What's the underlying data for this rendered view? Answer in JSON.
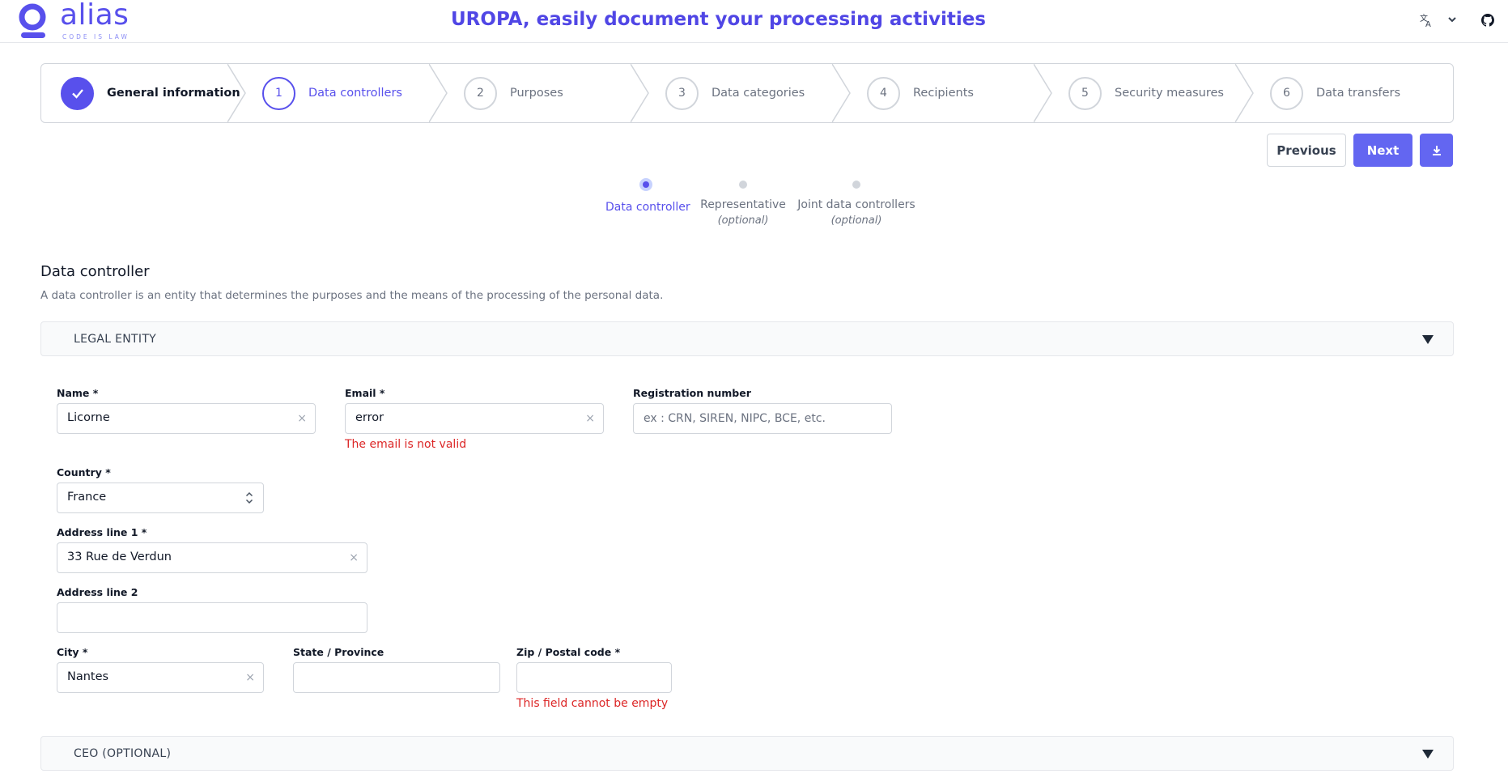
{
  "header": {
    "logo_word": "alias",
    "logo_tagline": "CODE IS LAW",
    "title": "UROPA, easily document your processing activities",
    "lang_icon": "translate-icon",
    "github_icon": "github-icon"
  },
  "steps": [
    {
      "number": "",
      "label": "General information",
      "state": "done"
    },
    {
      "number": "1",
      "label": "Data controllers",
      "state": "current"
    },
    {
      "number": "2",
      "label": "Purposes",
      "state": "todo"
    },
    {
      "number": "3",
      "label": "Data categories",
      "state": "todo"
    },
    {
      "number": "4",
      "label": "Recipients",
      "state": "todo"
    },
    {
      "number": "5",
      "label": "Security measures",
      "state": "todo"
    },
    {
      "number": "6",
      "label": "Data transfers",
      "state": "todo"
    }
  ],
  "nav": {
    "previous": "Previous",
    "next": "Next",
    "download_icon": "download-icon"
  },
  "substeps": [
    {
      "label": "Data controller",
      "optional": "",
      "active": true
    },
    {
      "label": "Representative",
      "optional": "(optional)",
      "active": false
    },
    {
      "label": "Joint data controllers",
      "optional": "(optional)",
      "active": false
    }
  ],
  "section": {
    "title": "Data controller",
    "description": "A data controller is an entity that determines the purposes and the means of the processing of the personal data."
  },
  "accordions": {
    "legal_entity": "LEGAL ENTITY",
    "ceo": "CEO (OPTIONAL)"
  },
  "form": {
    "name": {
      "label": "Name *",
      "value": "Licorne"
    },
    "email": {
      "label": "Email *",
      "value": "error",
      "error": "The email is not valid"
    },
    "registration": {
      "label": "Registration number",
      "placeholder": "ex : CRN, SIREN, NIPC, BCE, etc."
    },
    "country": {
      "label": "Country *",
      "value": "France"
    },
    "address1": {
      "label": "Address line 1 *",
      "value": "33 Rue de Verdun"
    },
    "address2": {
      "label": "Address line 2",
      "value": ""
    },
    "city": {
      "label": "City *",
      "value": "Nantes"
    },
    "state": {
      "label": "State / Province",
      "value": ""
    },
    "zip": {
      "label": "Zip / Postal code *",
      "value": "",
      "error": "This field cannot be empty"
    },
    "clear_glyph": "×"
  },
  "colors": {
    "accent": "#5850ec",
    "error": "#dc2626"
  }
}
